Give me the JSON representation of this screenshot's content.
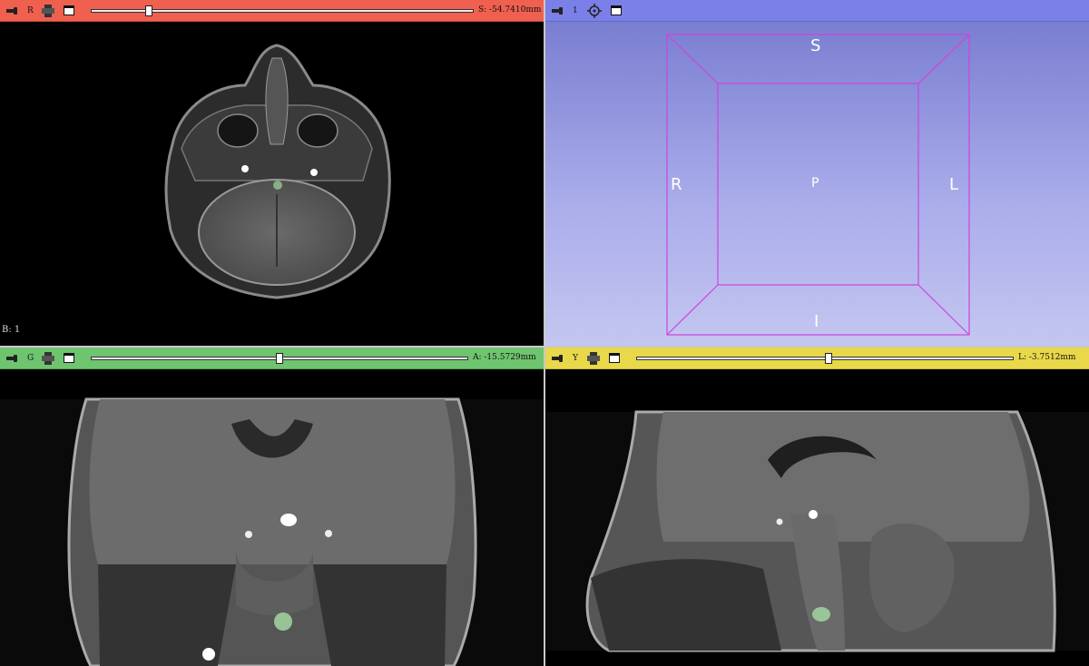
{
  "views": {
    "red": {
      "letter": "R",
      "offset": "S: -54.7410mm",
      "slider_fraction": 0.15,
      "color": "#f0604f",
      "corner_label": "B: 1"
    },
    "three_d": {
      "letter": "1",
      "color": "#7b7fe8",
      "orientation": {
        "superior": "S",
        "inferior": "I",
        "right": "R",
        "left": "L",
        "posterior": "P"
      }
    },
    "green": {
      "letter": "G",
      "offset": "A: -15.5729mm",
      "slider_fraction": 0.5,
      "color": "#6fc46f"
    },
    "yellow": {
      "letter": "Y",
      "offset": "L: -3.7512mm",
      "slider_fraction": 0.51,
      "color": "#e8d84a"
    }
  },
  "icons": {
    "pin": "pin-icon",
    "link": "link-icon",
    "maximize": "window-icon",
    "center": "center-view-icon"
  }
}
